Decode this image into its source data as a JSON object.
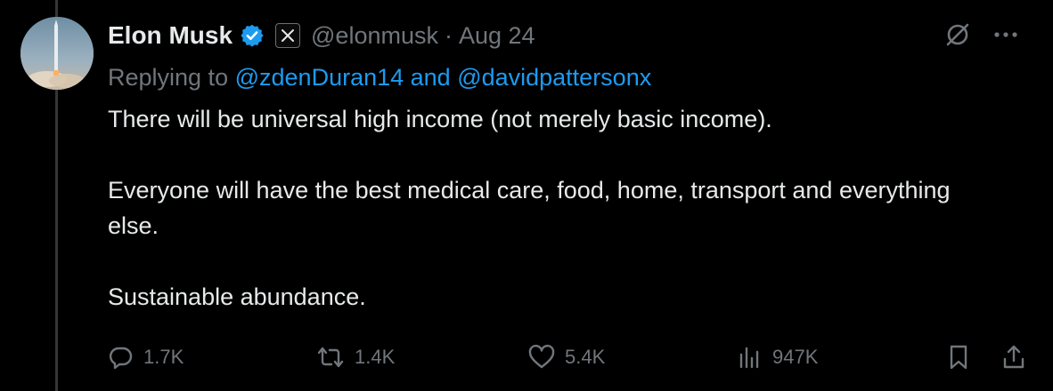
{
  "tweet": {
    "author_name": "Elon Musk",
    "handle": "@elonmusk",
    "separator": "·",
    "date": "Aug 24",
    "reply_prefix": "Replying to",
    "reply_mentions": "@zdenDuran14 and @davidpattersonx",
    "paragraphs": [
      "There will be universal high income (not merely basic income).",
      "Everyone will have the best medical care, food, home, transport and everything else.",
      "Sustainable abundance."
    ]
  },
  "actions": {
    "replies": "1.7K",
    "reposts": "1.4K",
    "likes": "5.4K",
    "views": "947K"
  },
  "icons": {
    "verified": "verified-badge-icon",
    "affiliate": "x-logo-icon",
    "grok": "grok-icon",
    "more": "more-icon",
    "reply": "reply-icon",
    "repost": "repost-icon",
    "like": "heart-icon",
    "views": "views-icon",
    "bookmark": "bookmark-icon",
    "share": "share-icon"
  },
  "colors": {
    "background": "#000000",
    "text": "#e7e9ea",
    "muted": "#71767b",
    "accent": "#1d9bf0"
  }
}
